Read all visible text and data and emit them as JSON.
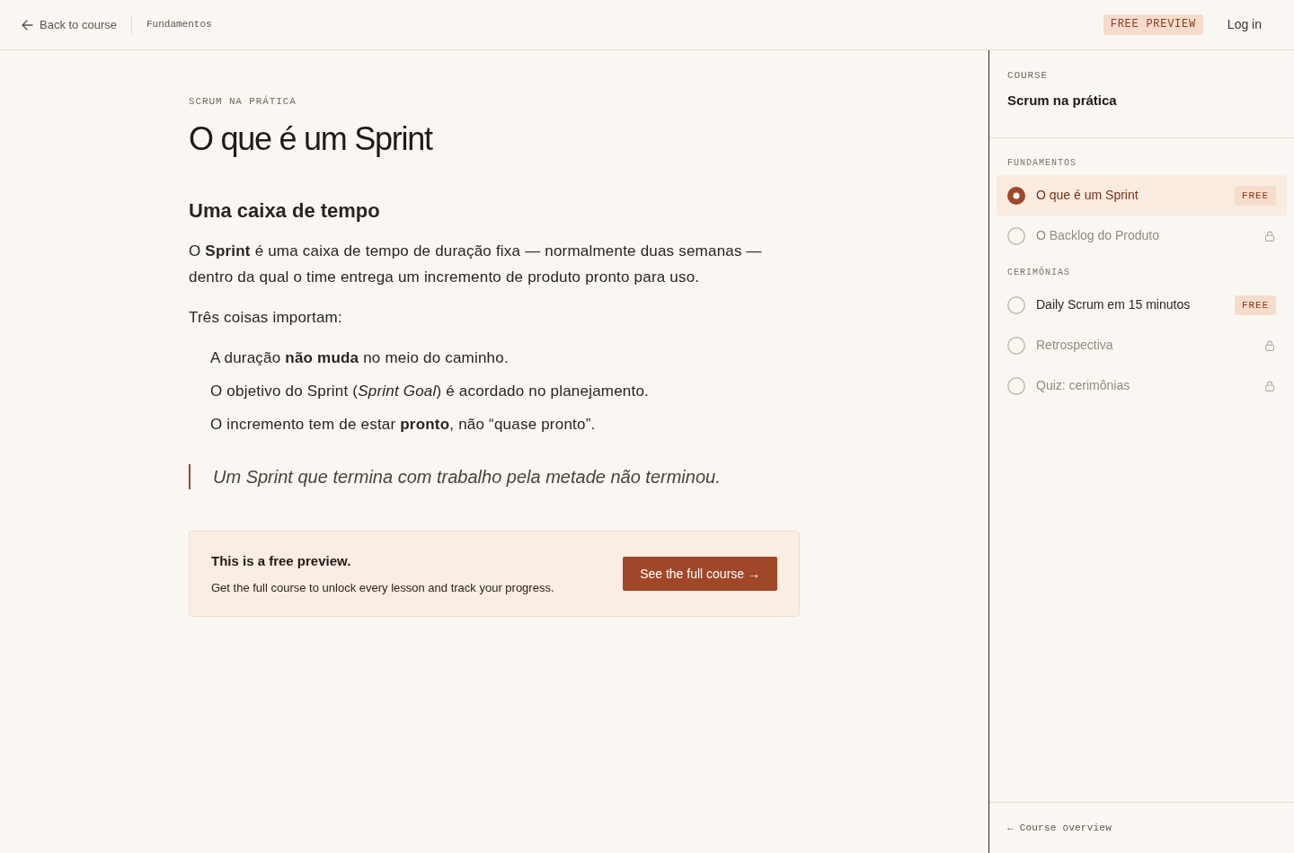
{
  "header": {
    "back_link": "Back to course",
    "breadcrumb": "Fundamentos",
    "badge": "FREE PREVIEW",
    "login_link": "Log in"
  },
  "lesson": {
    "eyebrow": "SCRUM NA PRÁTICA",
    "title": "O que é um Sprint",
    "blocks": [
      {
        "kind": "heading",
        "text": "Uma caixa de tempo"
      },
      {
        "kind": "paragraph",
        "text": "O **Sprint** é uma caixa de tempo de duração fixa — normalmente duas semanas — dentro da qual o time entrega um incremento de produto pronto para uso."
      },
      {
        "kind": "paragraph",
        "text": "Três coisas importam:"
      },
      {
        "kind": "list",
        "items": [
          "A duração **não muda** no meio do caminho.",
          "O objetivo do Sprint (*Sprint Goal*) é acordado no planejamento.",
          "O incremento tem de estar **pronto**, não “quase pronto”."
        ]
      },
      {
        "kind": "quote",
        "text": "Um Sprint que termina com trabalho pela metade não terminou."
      }
    ],
    "upsell": {
      "title": "This is a free preview.",
      "text": "Get the full course to unlock every lesson and track your progress.",
      "button": "See the full course →"
    }
  },
  "sidebar": {
    "label": "COURSE",
    "course_title": "Scrum na prática",
    "sections": [
      {
        "title": "FUNDAMENTOS",
        "lessons": [
          {
            "title": "O que é um Sprint",
            "selected": true,
            "locked": false,
            "badge": "FREE"
          },
          {
            "title": "O Backlog do Produto",
            "selected": false,
            "locked": true
          }
        ]
      },
      {
        "title": "CERIMÔNIAS",
        "lessons": [
          {
            "title": "Daily Scrum em 15 minutos",
            "selected": false,
            "locked": false,
            "badge": "FREE"
          },
          {
            "title": "Retrospectiva",
            "selected": false,
            "locked": true
          },
          {
            "title": "Quiz: cerimônias",
            "selected": false,
            "locked": true
          }
        ]
      }
    ],
    "footer_link": "← Course overview"
  }
}
